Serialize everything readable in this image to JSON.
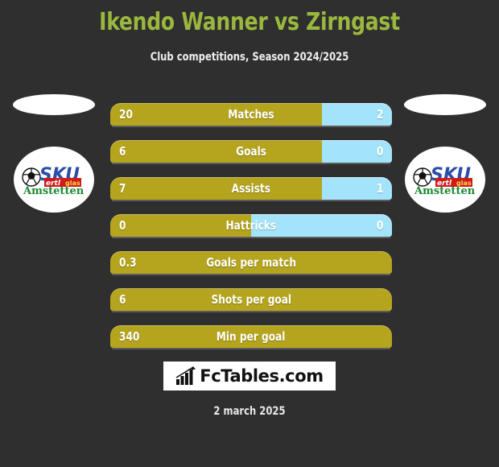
{
  "header": {
    "title": "Ikendo Wanner vs Zirngast",
    "subtitle": "Club competitions, Season 2024/2025",
    "title_color": "#9ab73e"
  },
  "colors": {
    "background": "#2f2f2f",
    "home_bar": "#b5a41d",
    "away_bar": "#a3e4fa",
    "text": "#ffffff"
  },
  "players": [
    {
      "side": "left",
      "photo": "player-photo-placeholder",
      "club_logo": "sku-amstetten-logo"
    },
    {
      "side": "right",
      "photo": "player-photo-placeholder",
      "club_logo": "sku-amstetten-logo"
    }
  ],
  "club_logo": {
    "name": "SKU Amstetten",
    "word_top": "SKU",
    "word_bottom": "Amstetten",
    "sponsor": "ertl glas",
    "ball_icon": "soccer-ball-icon"
  },
  "stats": [
    {
      "label": "Matches",
      "home": "20",
      "away": "2",
      "home_pct": 75,
      "has_away": true
    },
    {
      "label": "Goals",
      "home": "6",
      "away": "0",
      "home_pct": 75,
      "has_away": true
    },
    {
      "label": "Assists",
      "home": "7",
      "away": "1",
      "home_pct": 75,
      "has_away": true
    },
    {
      "label": "Hattricks",
      "home": "0",
      "away": "0",
      "home_pct": 50,
      "has_away": true
    },
    {
      "label": "Goals per match",
      "home": "0.3",
      "away": "",
      "home_pct": 100,
      "has_away": false
    },
    {
      "label": "Shots per goal",
      "home": "6",
      "away": "",
      "home_pct": 100,
      "has_away": false
    },
    {
      "label": "Min per goal",
      "home": "340",
      "away": "",
      "home_pct": 100,
      "has_away": false
    }
  ],
  "footer": {
    "brand": "FcTables.com",
    "brand_icon": "bar-chart-icon",
    "date": "2 march 2025"
  },
  "chart_data": {
    "type": "bar",
    "title": "Ikendo Wanner vs Zirngast",
    "subtitle": "Club competitions, Season 2024/2025",
    "categories": [
      "Matches",
      "Goals",
      "Assists",
      "Hattricks",
      "Goals per match",
      "Shots per goal",
      "Min per goal"
    ],
    "series": [
      {
        "name": "Ikendo Wanner",
        "values": [
          20,
          6,
          7,
          0,
          0.3,
          6,
          340
        ]
      },
      {
        "name": "Zirngast",
        "values": [
          2,
          0,
          1,
          0,
          null,
          null,
          null
        ]
      }
    ],
    "legend_position": "none",
    "grid": false
  }
}
